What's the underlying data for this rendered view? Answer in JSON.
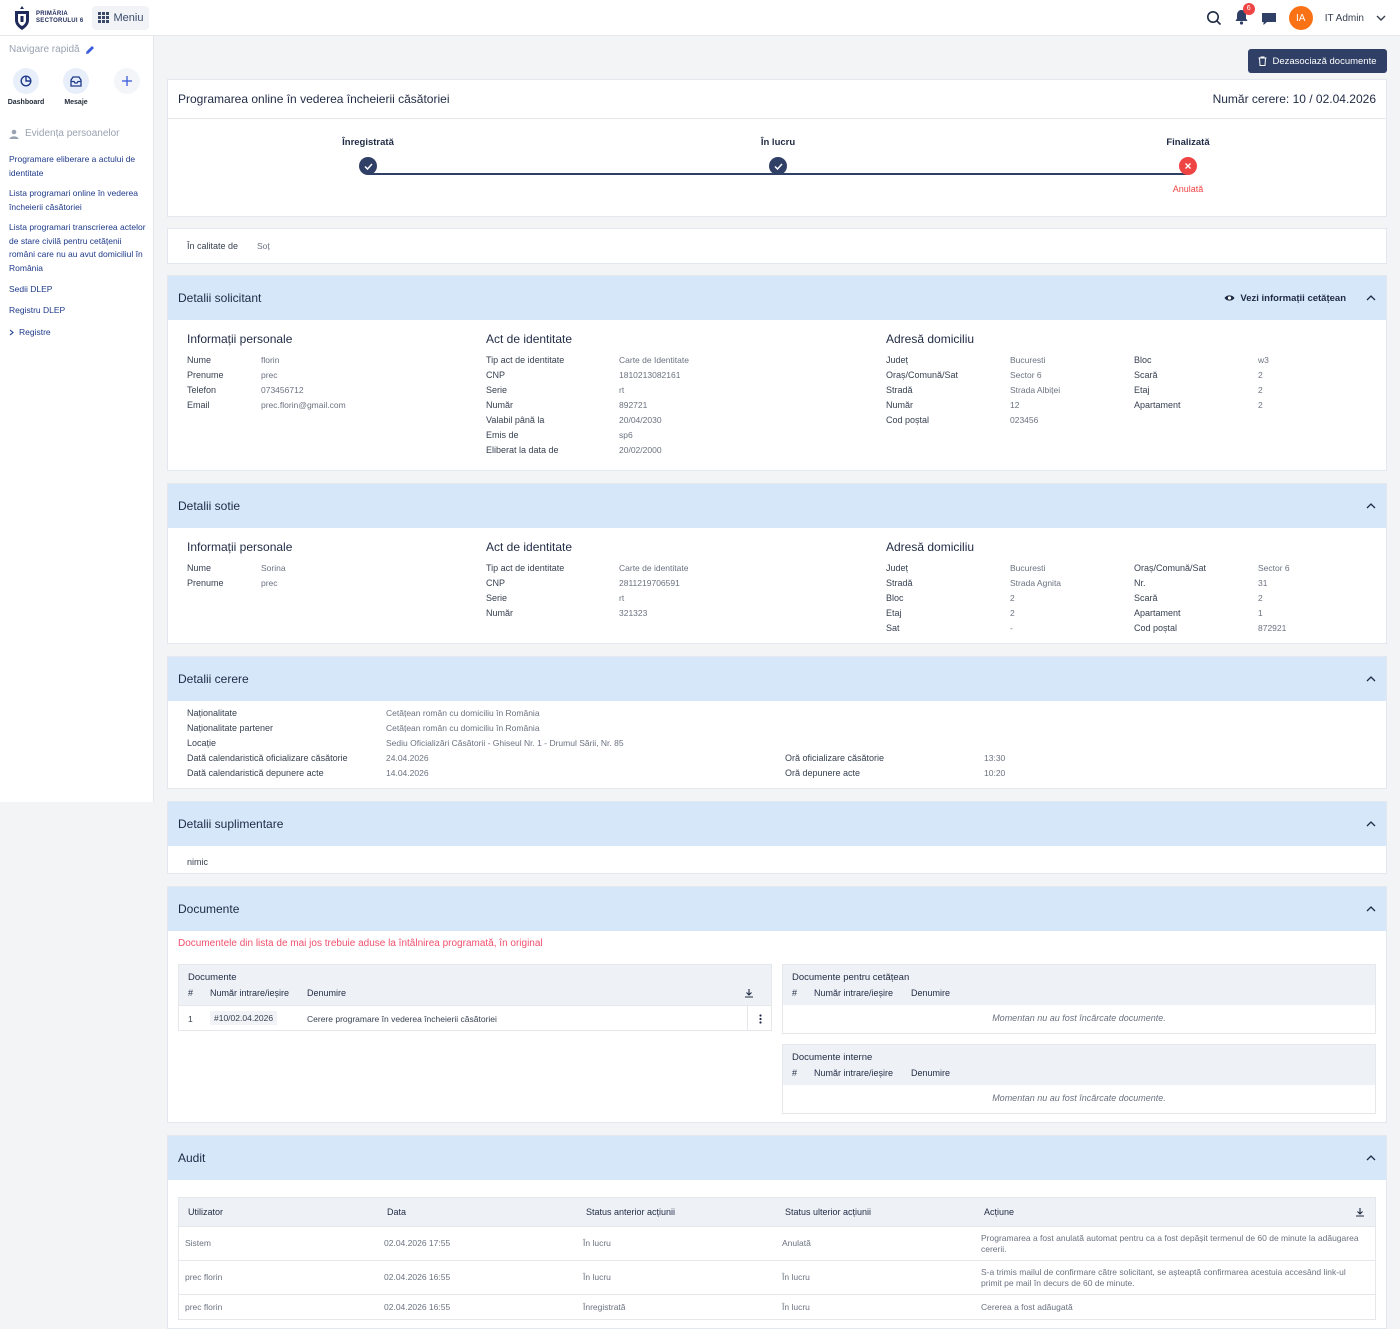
{
  "header": {
    "logo_line1": "PRIMĂRIA",
    "logo_line2": "SECTORULUI 6",
    "menu_label": "Meniu",
    "notifications_count": "6",
    "avatar_initials": "IA",
    "user_name": "IT Admin"
  },
  "sidebar": {
    "quick_nav_title": "Navigare rapidă",
    "quick_items": [
      {
        "label": "Dashboard"
      },
      {
        "label": "Mesaje"
      }
    ],
    "section_title": "Evidența persoanelor",
    "links": [
      {
        "label": "Programare eliberare a actului de identitate"
      },
      {
        "label": "Lista programari online în vederea încheierii căsătoriei"
      },
      {
        "label": "Lista programari transcrierea actelor de stare civilă pentru cetățenii români care nu au avut domiciliul în România"
      },
      {
        "label": "Sedii DLEP"
      },
      {
        "label": "Registru DLEP"
      },
      {
        "label": "Registre"
      }
    ]
  },
  "top_button": "Dezasociază documente",
  "status": {
    "title": "Programarea online în vederea încheierii căsătoriei",
    "request_number": "Număr cerere: 10 / 02.04.2026",
    "steps": [
      {
        "label": "Înregistrată",
        "state": "done"
      },
      {
        "label": "În lucru",
        "state": "done"
      },
      {
        "label": "Finalizată",
        "state": "cancelled",
        "sub": "Anulată"
      }
    ]
  },
  "calitate": {
    "label": "În calitate de",
    "value": "Soț"
  },
  "solicitant": {
    "title": "Detalii solicitant",
    "view_link": "Vezi informații cetățean",
    "personal_title": "Informații personale",
    "personal": [
      {
        "label": "Nume",
        "value": "florin"
      },
      {
        "label": "Prenume",
        "value": "prec"
      },
      {
        "label": "Telefon",
        "value": "073456712"
      },
      {
        "label": "Email",
        "value": "prec.florin@gmail.com"
      }
    ],
    "id_title": "Act de identitate",
    "id": [
      {
        "label": "Tip act de identitate",
        "value": "Carte de Identitate"
      },
      {
        "label": "CNP",
        "value": "1810213082161"
      },
      {
        "label": "Serie",
        "value": "rt"
      },
      {
        "label": "Număr",
        "value": "892721"
      },
      {
        "label": "Valabil până la",
        "value": "20/04/2030"
      },
      {
        "label": "Emis de",
        "value": "sp6"
      },
      {
        "label": "Eliberat la data de",
        "value": "20/02/2000"
      }
    ],
    "address_title": "Adresă domiciliu",
    "address_a": [
      {
        "label": "Județ",
        "value": "Bucuresti"
      },
      {
        "label": "Oraș/Comună/Sat",
        "value": "Sector 6"
      },
      {
        "label": "Stradă",
        "value": "Strada Albiței"
      },
      {
        "label": "Număr",
        "value": "12"
      },
      {
        "label": "Cod poștal",
        "value": "023456"
      }
    ],
    "address_b": [
      {
        "label": "Bloc",
        "value": "w3"
      },
      {
        "label": "Scară",
        "value": "2"
      },
      {
        "label": "Etaj",
        "value": "2"
      },
      {
        "label": "Apartament",
        "value": "2"
      }
    ]
  },
  "sotie": {
    "title": "Detalii sotie",
    "personal_title": "Informații personale",
    "personal": [
      {
        "label": "Nume",
        "value": "Sorina"
      },
      {
        "label": "Prenume",
        "value": "prec"
      }
    ],
    "id_title": "Act de identitate",
    "id": [
      {
        "label": "Tip act de identitate",
        "value": "Carte de identitate"
      },
      {
        "label": "CNP",
        "value": "2811219706591"
      },
      {
        "label": "Serie",
        "value": "rt"
      },
      {
        "label": "Număr",
        "value": "321323"
      }
    ],
    "address_title": "Adresă domiciliu",
    "address_a": [
      {
        "label": "Județ",
        "value": "Bucuresti"
      },
      {
        "label": "Stradă",
        "value": "Strada Agnita"
      },
      {
        "label": "Bloc",
        "value": "2"
      },
      {
        "label": "Etaj",
        "value": "2"
      },
      {
        "label": "Sat",
        "value": "-"
      }
    ],
    "address_b": [
      {
        "label": "Oraș/Comună/Sat",
        "value": "Sector 6"
      },
      {
        "label": "Nr.",
        "value": "31"
      },
      {
        "label": "Scară",
        "value": "2"
      },
      {
        "label": "Apartament",
        "value": "1"
      },
      {
        "label": "Cod poștal",
        "value": "872921"
      }
    ]
  },
  "cerere": {
    "title": "Detalii cerere",
    "rows": [
      {
        "label": "Naționalitate",
        "value": "Cetățean român cu domiciliu în România"
      },
      {
        "label": "Naționalitate partener",
        "value": "Cetățean român cu domiciliu în România"
      },
      {
        "label": "Locație",
        "value": "Sediu Oficializări Căsătorii - Ghiseul Nr. 1 - Drumul Sării, Nr. 85"
      },
      {
        "label": "Dată calendaristică oficializare căsătorie",
        "value": "24.04.2026"
      },
      {
        "label": "Dată calendaristică depunere acte",
        "value": "14.04.2026"
      }
    ],
    "right_rows": [
      {
        "label": "Oră oficializare căsătorie",
        "value": "13:30"
      },
      {
        "label": "Oră depunere acte",
        "value": "10:20"
      }
    ]
  },
  "suplimentare": {
    "title": "Detalii suplimentare",
    "text": "nimic"
  },
  "documente": {
    "title": "Documente",
    "note": "Documentele din lista de mai jos trebuie aduse la întâlnirea programată, în original",
    "col_hash": "#",
    "col_num": "Număr intrare/ieșire",
    "col_name": "Denumire",
    "main_box_title": "Documente",
    "rows": [
      {
        "idx": "1",
        "num": "#10/02.04.2026",
        "name": "Cerere programare în vederea încheierii căsătoriei"
      }
    ],
    "citizen_box_title": "Documente pentru cetățean",
    "internal_box_title": "Documente interne",
    "empty": "Momentan nu au fost încărcate documente."
  },
  "audit": {
    "title": "Audit",
    "columns": [
      "Utilizator",
      "Data",
      "Status anterior acțiunii",
      "Status ulterior acțiunii",
      "Acțiune"
    ],
    "rows": [
      {
        "user": "Sistem",
        "date": "02.04.2026 17:55",
        "before": "În lucru",
        "after": "Anulată",
        "action": "Programarea a fost anulată automat pentru ca a fost depășit termenul de 60 de minute la adăugarea cererii."
      },
      {
        "user": "prec florin",
        "date": "02.04.2026 16:55",
        "before": "În lucru",
        "after": "În lucru",
        "action": "S-a trimis mailul de confirmare către solicitant, se așteaptă confirmarea acestuia accesând link-ul primit pe mail în decurs de 60 de minute."
      },
      {
        "user": "prec florin",
        "date": "02.04.2026 16:55",
        "before": "Înregistrată",
        "after": "În lucru",
        "action": "Cererea a fost adăugată"
      }
    ]
  },
  "colors": {
    "accent": "#2f3f66",
    "section_header": "#d6e7fa",
    "danger": "#ef4444",
    "avatar": "#f97316"
  }
}
